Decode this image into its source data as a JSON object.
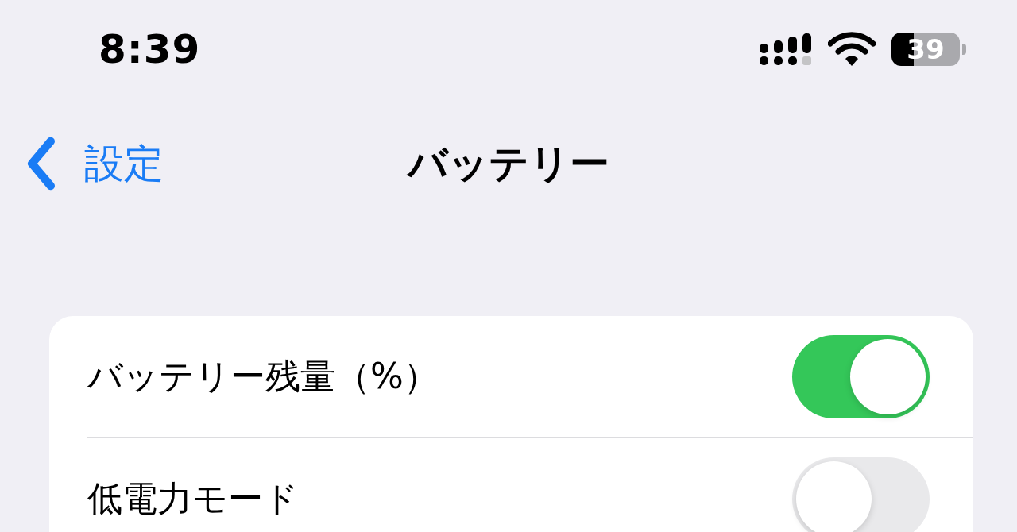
{
  "status_bar": {
    "time": "8:39",
    "battery": "39"
  },
  "nav": {
    "back": "設定",
    "title": "バッテリー"
  },
  "settings": [
    {
      "label": "バッテリー残量（%）",
      "on": true
    },
    {
      "label": "低電力モード",
      "on": false
    }
  ]
}
